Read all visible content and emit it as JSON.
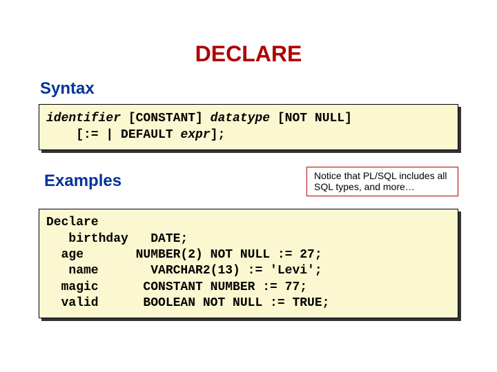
{
  "title": "DECLARE",
  "syntax": {
    "label": "Syntax",
    "line1_pre": "identifier",
    "line1_mid": " [CONSTANT] ",
    "line1_dt": "datatype",
    "line1_post": " [NOT NULL]",
    "line2_pre": "    [:= | DEFAULT ",
    "line2_expr": "expr",
    "line2_post": "];"
  },
  "examples": {
    "label": "Examples",
    "notice": "Notice that PL/SQL includes all SQL types, and more…",
    "code": "Declare\n   birthday   DATE;\n  age       NUMBER(2) NOT NULL := 27;\n   name       VARCHAR2(13) := 'Levi';\n  magic      CONSTANT NUMBER := 77;\n  valid      BOOLEAN NOT NULL := TRUE;"
  }
}
